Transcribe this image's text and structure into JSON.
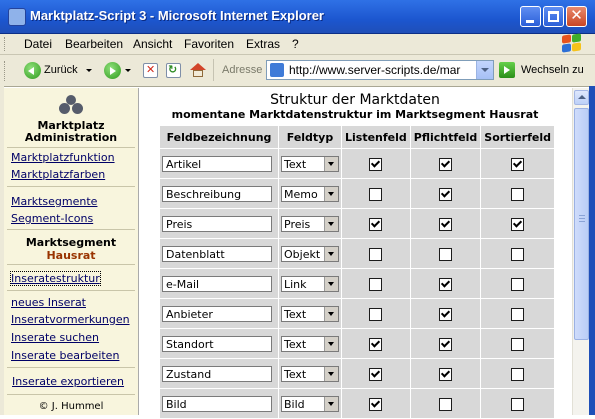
{
  "window": {
    "title": "Marktplatz-Script 3 - Microsoft Internet Explorer"
  },
  "menubar": [
    "Datei",
    "Bearbeiten",
    "Ansicht",
    "Favoriten",
    "Extras",
    "?"
  ],
  "toolbar": {
    "back_label": "Zurück",
    "address_label": "Adresse",
    "address_value": "http://www.server-scripts.de/mar",
    "go_label": "Wechseln zu"
  },
  "sidebar": {
    "heading_line1": "Marktplatz",
    "heading_line2": "Administration",
    "links": [
      "Marktplatzfunktion",
      "Marktplatzfarben",
      "Marktsegmente",
      "Segment-Icons"
    ],
    "segment_label": "Marktsegment",
    "segment_name": "Hausrat",
    "current_item": "Inseratestruktur",
    "links2": [
      "neues Inserat",
      "Inseratvormerkungen",
      "Inserate suchen",
      "Inserate bearbeiten"
    ],
    "export_link": "Inserate exportieren",
    "copyright": "© J. Hummel"
  },
  "main": {
    "title": "Struktur der Marktdaten",
    "subtitle": "momentane Marktdatenstruktur im Marktsegment Hausrat",
    "columns": [
      "Feldbezeichnung",
      "Feldtyp",
      "Listenfeld",
      "Pflichtfeld",
      "Sortierfeld"
    ],
    "rows": [
      {
        "name": "Artikel",
        "type": "Text",
        "list": true,
        "required": true,
        "sort": true
      },
      {
        "name": "Beschreibung",
        "type": "Memo",
        "list": false,
        "required": true,
        "sort": false
      },
      {
        "name": "Preis",
        "type": "Preis",
        "list": true,
        "required": true,
        "sort": true
      },
      {
        "name": "Datenblatt",
        "type": "Objekt",
        "list": false,
        "required": false,
        "sort": false
      },
      {
        "name": "e-Mail",
        "type": "Link",
        "list": false,
        "required": true,
        "sort": false
      },
      {
        "name": "Anbieter",
        "type": "Text",
        "list": false,
        "required": true,
        "sort": false
      },
      {
        "name": "Standort",
        "type": "Text",
        "list": true,
        "required": true,
        "sort": false
      },
      {
        "name": "Zustand",
        "type": "Text",
        "list": true,
        "required": true,
        "sort": false
      },
      {
        "name": "Bild",
        "type": "Bild",
        "list": true,
        "required": false,
        "sort": false
      }
    ]
  },
  "colors": {
    "titlebar": "#2f71e6",
    "sidebar_bg": "#f8f5dd",
    "link": "#000066",
    "segment_accent": "#993300",
    "table_cell": "#d8d8d8"
  }
}
